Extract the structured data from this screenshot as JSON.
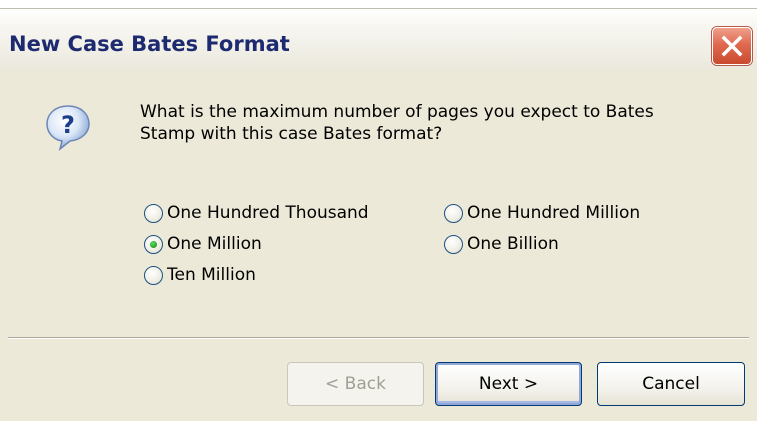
{
  "window": {
    "title": "New Case Bates Format"
  },
  "dialog": {
    "question_line1": "What is the maximum number of pages you expect to Bates",
    "question_line2": "Stamp with this case Bates format?",
    "icon": "question-icon",
    "options": [
      {
        "label": "One Hundred Thousand",
        "selected": false
      },
      {
        "label": "One Hundred Million",
        "selected": false
      },
      {
        "label": "One Million",
        "selected": true
      },
      {
        "label": "One Billion",
        "selected": false
      },
      {
        "label": "Ten Million",
        "selected": false
      }
    ]
  },
  "buttons": {
    "back_label": "< Back",
    "back_enabled": false,
    "next_label": "Next >",
    "cancel_label": "Cancel"
  },
  "colors": {
    "title_text": "#1e2a70",
    "dialog_bg": "#ece9d8",
    "close_button": "#e06a50",
    "radio_selected": "#21a121"
  }
}
